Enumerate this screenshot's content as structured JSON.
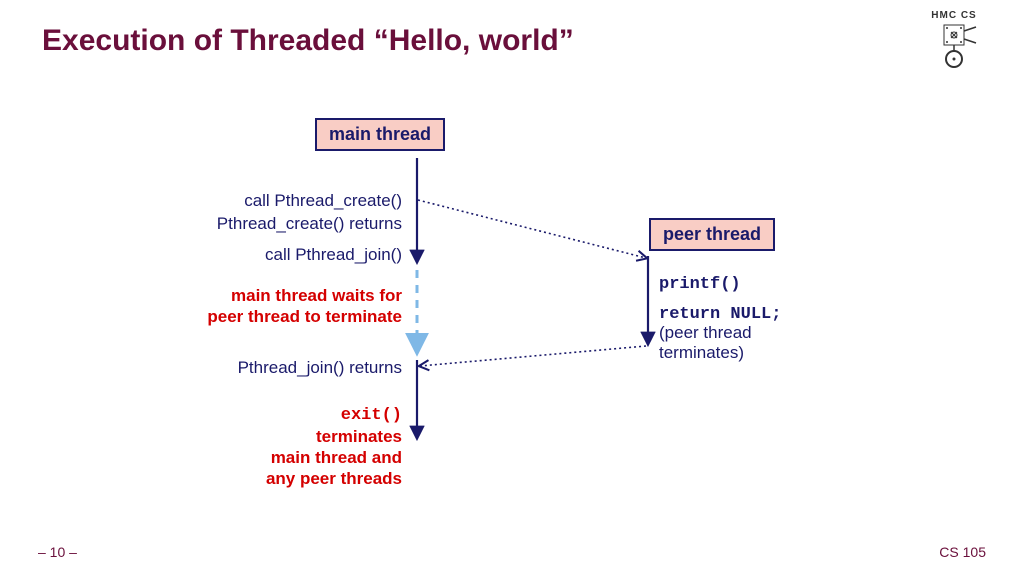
{
  "title": "Execution of Threaded “Hello, world”",
  "logo_text": "HMC CS",
  "boxes": {
    "main_thread": "main thread",
    "peer_thread": "peer thread"
  },
  "main_labels": {
    "call_create": "call Pthread_create()",
    "create_returns": "Pthread_create() returns",
    "call_join": "call Pthread_join()",
    "wait_line1": "main thread waits for",
    "wait_line2": "peer  thread to terminate",
    "join_returns": "Pthread_join() returns",
    "exit": "exit()",
    "term_line1": "terminates",
    "term_line2": "main thread and",
    "term_line3": "any peer threads"
  },
  "peer_labels": {
    "printf": "printf()",
    "return_null": "return NULL;",
    "terminates_line1": "(peer thread",
    "terminates_line2": "terminates)"
  },
  "footer": {
    "page": "– 10 –",
    "course": "CS 105"
  },
  "colors": {
    "title": "#6a0f3b",
    "navy": "#1a1a6a",
    "red": "#d40000",
    "box_fill": "#f9cdc5"
  }
}
